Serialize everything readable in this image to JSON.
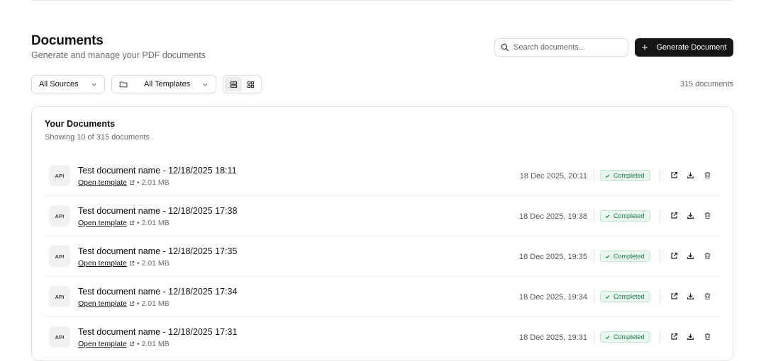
{
  "header": {
    "title": "Documents",
    "subtitle": "Generate and manage your PDF documents"
  },
  "search": {
    "placeholder": "Search documents...",
    "value": ""
  },
  "generate_button": {
    "label": "Generate Document"
  },
  "filters": {
    "sources": {
      "selected": "All Sources"
    },
    "templates": {
      "selected": "All Templates"
    },
    "view_mode": "list"
  },
  "document_count": "315 documents",
  "card": {
    "title": "Your Documents",
    "subtitle": "Showing 10 of 315 documents"
  },
  "documents": [
    {
      "badge": "API",
      "name": "Test document name - 12/18/2025 18:11",
      "template_link": "Open template",
      "size": "• 2.01 MB",
      "date": "18 Dec 2025, 20:11",
      "status": "Completed"
    },
    {
      "badge": "API",
      "name": "Test document name - 12/18/2025 17:38",
      "template_link": "Open template",
      "size": "• 2.01 MB",
      "date": "18 Dec 2025, 19:38",
      "status": "Completed"
    },
    {
      "badge": "API",
      "name": "Test document name - 12/18/2025 17:35",
      "template_link": "Open template",
      "size": "• 2.01 MB",
      "date": "18 Dec 2025, 19:35",
      "status": "Completed"
    },
    {
      "badge": "API",
      "name": "Test document name - 12/18/2025 17:34",
      "template_link": "Open template",
      "size": "• 2.01 MB",
      "date": "18 Dec 2025, 19:34",
      "status": "Completed"
    },
    {
      "badge": "API",
      "name": "Test document name - 12/18/2025 17:31",
      "template_link": "Open template",
      "size": "• 2.01 MB",
      "date": "18 Dec 2025, 19:31",
      "status": "Completed"
    }
  ],
  "colors": {
    "primary_button": "#161616",
    "status_completed_text": "#1d7a4a",
    "status_completed_bg": "#eaf7ef",
    "status_completed_border": "#bfe3cf"
  },
  "icons": {
    "search": "search-icon",
    "generate": "plus-icon",
    "dropdown": "chevron-down-icon",
    "templates": "folder-icon",
    "list_view": "list-view-icon",
    "grid_view": "grid-view-icon",
    "open_template": "external-link-icon",
    "status": "check-icon",
    "row_open": "open-external-icon",
    "row_download": "download-icon",
    "row_delete": "trash-icon"
  }
}
